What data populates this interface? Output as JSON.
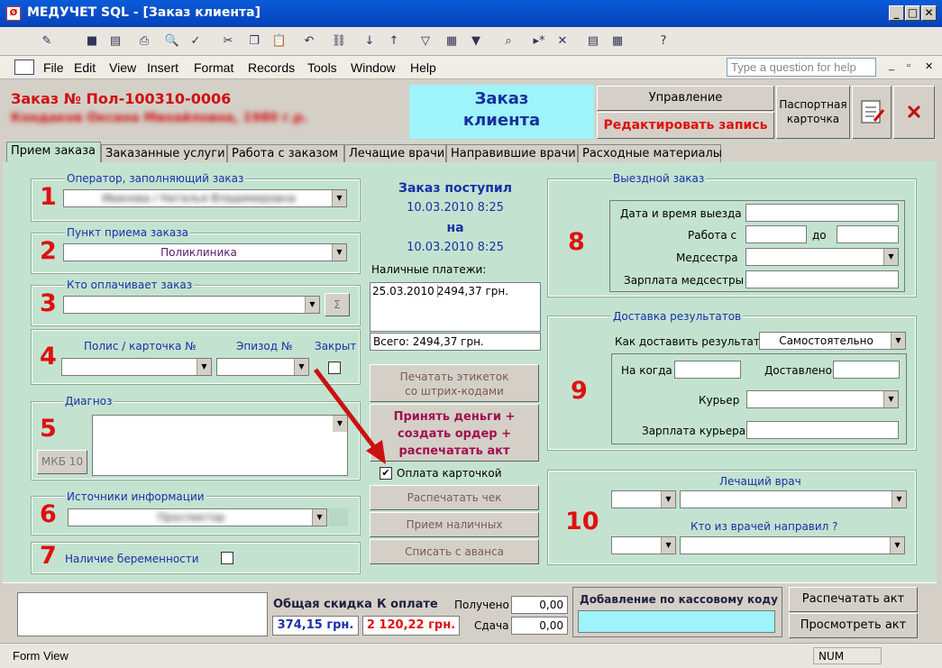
{
  "window": {
    "app_icon": "Ø",
    "title": "МЕДУЧЕТ SQL - [Заказ клиента]",
    "minimize": "_",
    "maximize": "□",
    "close": "✕"
  },
  "toolbar": {
    "icons": [
      "design-view-icon",
      "save-icon",
      "save-record-icon",
      "print-icon",
      "print-preview-icon",
      "spelling-icon",
      "cut-icon",
      "copy-icon",
      "paste-icon",
      "undo-icon",
      "hyperlink-icon",
      "sort-asc-icon",
      "sort-desc-icon",
      "filter-selection-icon",
      "filter-form-icon",
      "apply-filter-icon",
      "find-icon",
      "new-record-icon",
      "delete-record-icon",
      "database-window-icon",
      "new-object-icon",
      "help-icon"
    ],
    "glyphs": [
      "✎",
      "■",
      "▤",
      "⎙",
      "🔍",
      "✓",
      "✂",
      "❐",
      "📋",
      "↶",
      "⛓",
      "↓",
      "↑",
      "▽",
      "▦",
      "▼",
      "⌕",
      "▸*",
      "✕",
      "▤",
      "▦",
      "?"
    ]
  },
  "menu": {
    "items": [
      "File",
      "Edit",
      "View",
      "Insert",
      "Format",
      "Records",
      "Tools",
      "Window",
      "Help"
    ],
    "help_placeholder": "Type a question for help",
    "doc_controls": [
      "_",
      "▫",
      "✕"
    ]
  },
  "header": {
    "order_label": "Заказ №",
    "order_no": "Пол-100310-0006",
    "patient_blurred": "Кондаков Оксана Михайловна, 1980 г.р.",
    "title_line1": "Заказ",
    "title_line2": "клиента",
    "manage_label": "Управление",
    "edit_label": "Редактировать запись",
    "passport_line1": "Паспортная",
    "passport_line2": "карточка"
  },
  "tabs": [
    "Прием заказа",
    "Заказанные услуги",
    "Работа с заказом",
    "Лечащие врачи",
    "Направившие врачи",
    "Расходные материалы"
  ],
  "left": {
    "g1": {
      "num": "1",
      "label": "Оператор, заполняющий заказ",
      "value": "Иванова / Наталья Владимировна"
    },
    "g2": {
      "num": "2",
      "label": "Пункт приема заказа",
      "value": "Поликлиника"
    },
    "g3": {
      "num": "3",
      "label": "Кто оплачивает заказ",
      "value": "",
      "sigma": "Σ"
    },
    "g4": {
      "num": "4",
      "policy": "Полис / карточка №",
      "episode": "Эпизод №",
      "closed": "Закрыт"
    },
    "g5": {
      "num": "5",
      "label": "Диагноз",
      "mkb": "МКБ 10"
    },
    "g6": {
      "num": "6",
      "label": "Источники информации",
      "value": "Проспектор"
    },
    "g7": {
      "num": "7",
      "label": "Наличие беременности"
    }
  },
  "middle": {
    "received": "Заказ поступил",
    "date1": "10.03.2010 8:25",
    "on": "на",
    "date2": "10.03.2010 8:25",
    "cash_label": "Наличные платежи:",
    "payment_date": "25.03.2010",
    "payment_amount": "2494,37 грн.",
    "total": "Всего: 2494,37 грн.",
    "print_labels": "Печатать этикеток",
    "print_labels2": "со штрих-кодами",
    "accept1": "Принять деньги +",
    "accept2": "создать ордер +",
    "accept3": "распечатать акт",
    "card_pay": "Оплата карточкой",
    "check_mark": "✔",
    "print_check": "Распечатать чек",
    "cash_receive": "Прием наличных",
    "write_off": "Списать с аванса"
  },
  "right": {
    "g8": {
      "num": "8",
      "label": "Выездной заказ",
      "departure": "Дата и время выезда",
      "work_from": "Работа с",
      "to": "до",
      "nurse": "Медсестра",
      "nurse_salary": "Зарплата медсестры"
    },
    "g9": {
      "num": "9",
      "label": "Доставка результатов",
      "how": "Как доставить результат?",
      "how_value": "Самостоятельно",
      "when": "На когда",
      "delivered": "Доставлено",
      "courier": "Курьер",
      "courier_salary": "Зарплата курьера"
    },
    "g10": {
      "num": "10",
      "doctor": "Лечащий врач",
      "referrer": "Кто из врачей направил ?"
    }
  },
  "footer": {
    "discount_label": "Общая скидка",
    "discount": "374,15 грн.",
    "topay_label": "К оплате",
    "topay": "2 120,22 грн.",
    "received_label": "Получено",
    "received": "0,00",
    "change_label": "Сдача",
    "change": "0,00",
    "cashcode_label": "Добавление по кассовому коду",
    "print_act": "Распечатать акт",
    "view_act": "Просмотреть акт"
  },
  "status": {
    "mode": "Form View",
    "num": "NUM"
  },
  "colors": {
    "form_bg": "#c3e3d0",
    "red": "#e01010",
    "blue": "#1a2fa8",
    "title_box": "#9ef4fa"
  }
}
